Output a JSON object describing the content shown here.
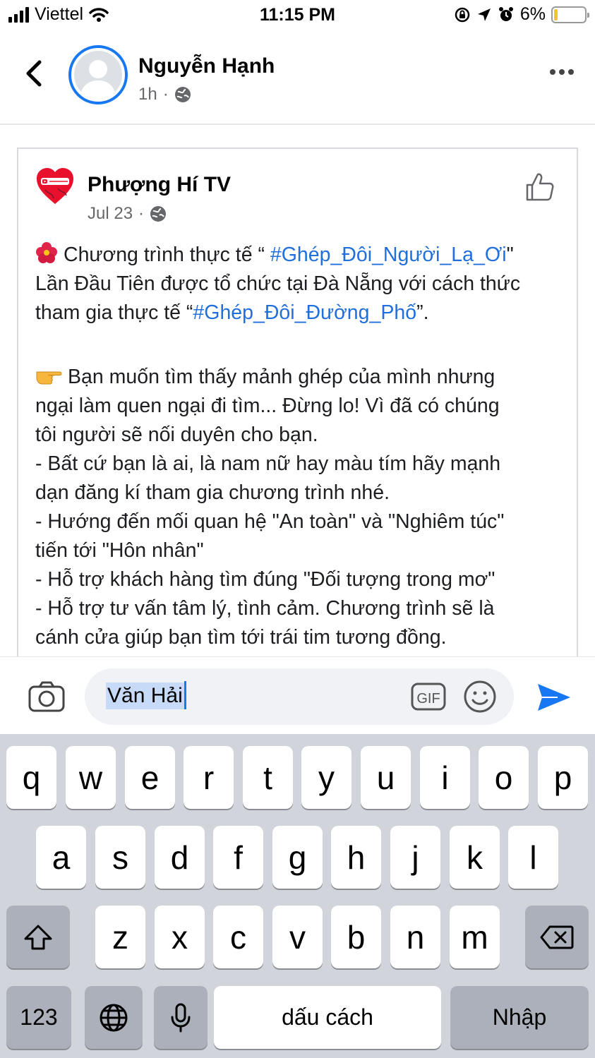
{
  "status_bar": {
    "carrier": "Viettel",
    "time": "11:15 PM",
    "battery": "6%",
    "battery_level": 0.06
  },
  "header": {
    "author_name": "Nguyễn Hạnh",
    "time_ago": "1h",
    "separator": "·"
  },
  "shared_post": {
    "page_name": "Phượng Hí TV",
    "date": "Jul 23",
    "separator": "·",
    "lines": {
      "l1_prefix": "Chương trình thực tế “ ",
      "l1_tag": "#Ghép_Đôi_Người_Lạ_Ơi",
      "l1_suffix": "\"",
      "l2": "Lần Đầu Tiên được tổ chức tại Đà Nẵng với cách thức",
      "l3_prefix": "tham gia thực tế “",
      "l3_tag": "#Ghép_Đôi_Đường_Phố",
      "l3_suffix": "”.",
      "l4": "Bạn muốn tìm thấy mảnh ghép của mình nhưng",
      "l5": "ngại làm quen ngại đi tìm... Đừng lo! Vì đã có chúng",
      "l6": "tôi người sẽ nối duyên cho bạn.",
      "l7": "- Bất cứ bạn là ai, là nam nữ hay màu tím hãy mạnh",
      "l8": "dạn đăng kí tham gia chương trình nhé.",
      "l9": "-  Hướng đến mối quan hệ \"An toàn\" và \"Nghiêm túc\"",
      "l10": "tiến tới \"Hôn nhân\"",
      "l11": "- Hỗ trợ khách hàng tìm đúng \"Đối tượng trong mơ\"",
      "l12": "- Hỗ trợ tư vấn tâm lý, tình cảm. Chương trình sẽ là",
      "l13": "cánh cửa giúp bạn tìm tới trái tim tương đồng."
    }
  },
  "comment": {
    "value": "Văn Hải",
    "gif_label": "GIF"
  },
  "keyboard": {
    "row1": [
      "q",
      "w",
      "e",
      "r",
      "t",
      "y",
      "u",
      "i",
      "o",
      "p"
    ],
    "row2": [
      "a",
      "s",
      "d",
      "f",
      "g",
      "h",
      "j",
      "k",
      "l"
    ],
    "row3": [
      "z",
      "x",
      "c",
      "v",
      "b",
      "n",
      "m"
    ],
    "numbers_label": "123",
    "space_label": "dấu cách",
    "return_label": "Nhập"
  },
  "colors": {
    "accent": "#1877f2",
    "hashtag": "#216fdb",
    "keyboard_bg": "#d1d4da"
  }
}
